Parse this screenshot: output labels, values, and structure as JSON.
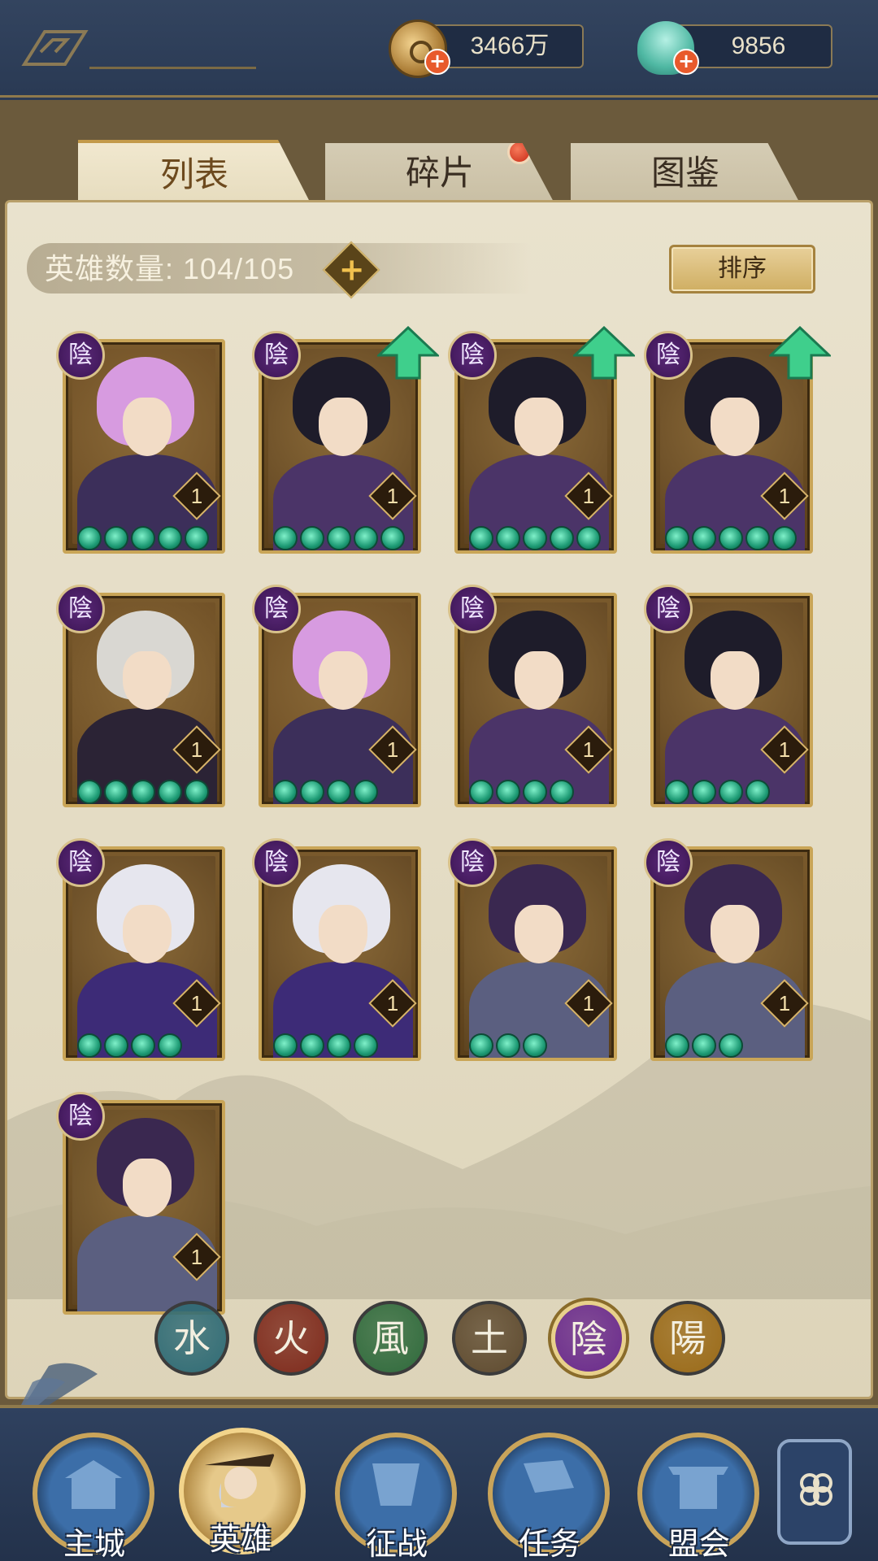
{
  "currencies": {
    "coins": {
      "value": "3466万",
      "icon": "coin-icon"
    },
    "jade": {
      "value": "9856",
      "icon": "jade-shell-icon"
    }
  },
  "tabs": [
    {
      "label": "列表",
      "active": true
    },
    {
      "label": "碎片",
      "active": false,
      "notification": true
    },
    {
      "label": "图鉴",
      "active": false
    }
  ],
  "hero_count": {
    "label": "英雄数量:",
    "value": "104/105"
  },
  "sort_button": "排序",
  "heroes": [
    {
      "element": "陰",
      "level": "1",
      "stars": 5,
      "upgrade": false,
      "style": "pink"
    },
    {
      "element": "陰",
      "level": "1",
      "stars": 5,
      "upgrade": true,
      "style": "dark"
    },
    {
      "element": "陰",
      "level": "1",
      "stars": 5,
      "upgrade": true,
      "style": "dark"
    },
    {
      "element": "陰",
      "level": "1",
      "stars": 5,
      "upgrade": true,
      "style": "dark"
    },
    {
      "element": "陰",
      "level": "1",
      "stars": 5,
      "upgrade": false,
      "style": "silver"
    },
    {
      "element": "陰",
      "level": "1",
      "stars": 4,
      "upgrade": false,
      "style": "pink"
    },
    {
      "element": "陰",
      "level": "1",
      "stars": 4,
      "upgrade": false,
      "style": "dark"
    },
    {
      "element": "陰",
      "level": "1",
      "stars": 4,
      "upgrade": false,
      "style": "dark"
    },
    {
      "element": "陰",
      "level": "1",
      "stars": 4,
      "upgrade": false,
      "style": "hat"
    },
    {
      "element": "陰",
      "level": "1",
      "stars": 4,
      "upgrade": false,
      "style": "hat"
    },
    {
      "element": "陰",
      "level": "1",
      "stars": 3,
      "upgrade": false,
      "style": "violet"
    },
    {
      "element": "陰",
      "level": "1",
      "stars": 3,
      "upgrade": false,
      "style": "violet"
    },
    {
      "element": "陰",
      "level": "1",
      "stars": 0,
      "upgrade": false,
      "style": "violet"
    }
  ],
  "element_filters": [
    {
      "glyph": "水",
      "color": "#2f6b75",
      "selected": false
    },
    {
      "glyph": "火",
      "color": "#7e2a1c",
      "selected": false
    },
    {
      "glyph": "風",
      "color": "#2f6a3c",
      "selected": false
    },
    {
      "glyph": "土",
      "color": "#5e4a2f",
      "selected": false
    },
    {
      "glyph": "陰",
      "color": "#6a2a8c",
      "selected": true
    },
    {
      "glyph": "陽",
      "color": "#9a6a18",
      "selected": false
    }
  ],
  "bottom_nav": [
    {
      "label": "主城",
      "icon": "city-gate-icon",
      "active": false
    },
    {
      "label": "英雄",
      "icon": "hero-portrait-icon",
      "active": true
    },
    {
      "label": "征战",
      "icon": "battle-horn-icon",
      "active": false
    },
    {
      "label": "任务",
      "icon": "scroll-flag-icon",
      "active": false
    },
    {
      "label": "盟会",
      "icon": "alliance-gate-icon",
      "active": false
    }
  ],
  "menu_icon": "four-petal-menu-icon"
}
